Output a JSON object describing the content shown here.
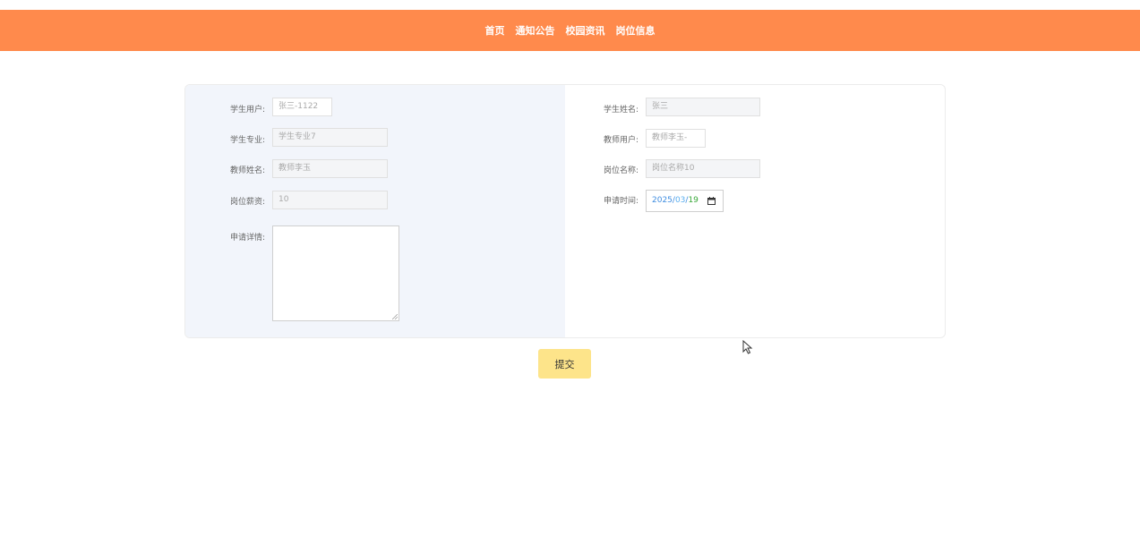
{
  "nav": {
    "items": [
      {
        "label": "首页"
      },
      {
        "label": "通知公告"
      },
      {
        "label": "校园资讯"
      },
      {
        "label": "岗位信息"
      }
    ]
  },
  "form": {
    "student_user": {
      "label": "学生用户:",
      "value": "张三-1122"
    },
    "student_name": {
      "label": "学生姓名:",
      "value": "张三"
    },
    "student_major": {
      "label": "学生专业:",
      "value": "学生专业7"
    },
    "teacher_user": {
      "label": "教师用户:",
      "value": "教师李玉-"
    },
    "teacher_name": {
      "label": "教师姓名:",
      "value": "教师李玉"
    },
    "position_name": {
      "label": "岗位名称:",
      "value": "岗位名称10"
    },
    "position_salary": {
      "label": "岗位薪资:",
      "value": "10"
    },
    "apply_time": {
      "label": "申请时间:",
      "year": "2025",
      "month": "03",
      "day": "19",
      "sep": "/"
    },
    "apply_detail": {
      "label": "申请详情:",
      "value": ""
    }
  },
  "submit": {
    "label": "提交"
  },
  "colors": {
    "topbar": "#ff8a4c",
    "left_panel": "#f2f5fb",
    "submit_button": "#fde48a"
  }
}
